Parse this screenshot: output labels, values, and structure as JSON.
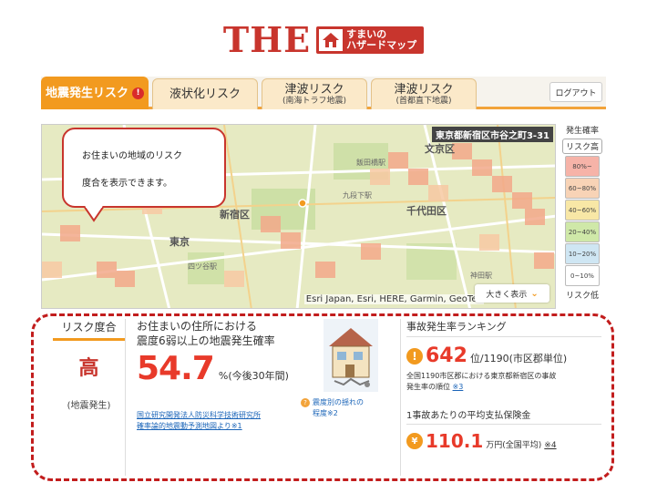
{
  "logo": {
    "the": "THE",
    "line1": "すまいの",
    "line2": "ハザードマップ"
  },
  "tabs": [
    {
      "main": "地震発生リスク",
      "sub": "",
      "badge": "!",
      "active": true
    },
    {
      "main": "液状化リスク",
      "sub": "",
      "active": false
    },
    {
      "main": "津波リスク",
      "sub": "(南海トラフ地震)",
      "active": false
    },
    {
      "main": "津波リスク",
      "sub": "(首都直下地震)",
      "active": false
    }
  ],
  "logout_label": "ログアウト",
  "map": {
    "address": "東京都新宿区市谷之町3-31",
    "attribution": "Esri Japan, Esri, HERE, Garmin, GeoTec",
    "enlarge_label": "大きく表示",
    "places": [
      "文京区",
      "千代田区",
      "新宿区",
      "東京"
    ],
    "small_places": [
      "飯田橋駅",
      "九段下駅",
      "四ツ谷駅",
      "神田駅"
    ]
  },
  "callout": {
    "line1": "お住まいの地域のリスク",
    "line2": "度合を表示できます。"
  },
  "legend": {
    "title": "発生確率",
    "high": "リスク高",
    "low": "リスク低",
    "bins": [
      {
        "label": "80%~",
        "color": "#f6b3a8"
      },
      {
        "label": "60~80%",
        "color": "#f8d3b6"
      },
      {
        "label": "40~60%",
        "color": "#f8e7a6"
      },
      {
        "label": "20~40%",
        "color": "#cfe8a8"
      },
      {
        "label": "10~20%",
        "color": "#cfe6f3"
      },
      {
        "label": "0~10%",
        "color": "#ffffff"
      }
    ]
  },
  "risk": {
    "title": "リスク度合",
    "level": "高",
    "type": "(地震発生)"
  },
  "probability": {
    "heading1": "お住まいの住所における",
    "heading2": "震度6弱以上の地震発生確率",
    "value": "54.7",
    "unit": "%(今後30年間)",
    "source1": "国立研究開発法人防災科学技術研究所",
    "source2": "確率論的地震動予測地図より※1",
    "help1": "震度別の揺れの",
    "help2": "程度※2"
  },
  "ranking": {
    "title": "事故発生率ランキング",
    "rank": "642",
    "rank_suffix": "位/1190(市区郡単位)",
    "desc1": "全国1190市区郡における東京都新宿区の事故",
    "desc2": "発生率の順位",
    "desc_note": "※3",
    "pay_title": "1事故あたりの平均支払保険金",
    "pay_value": "110.1",
    "pay_unit": "万円(全国平均)",
    "pay_note": "※4"
  }
}
